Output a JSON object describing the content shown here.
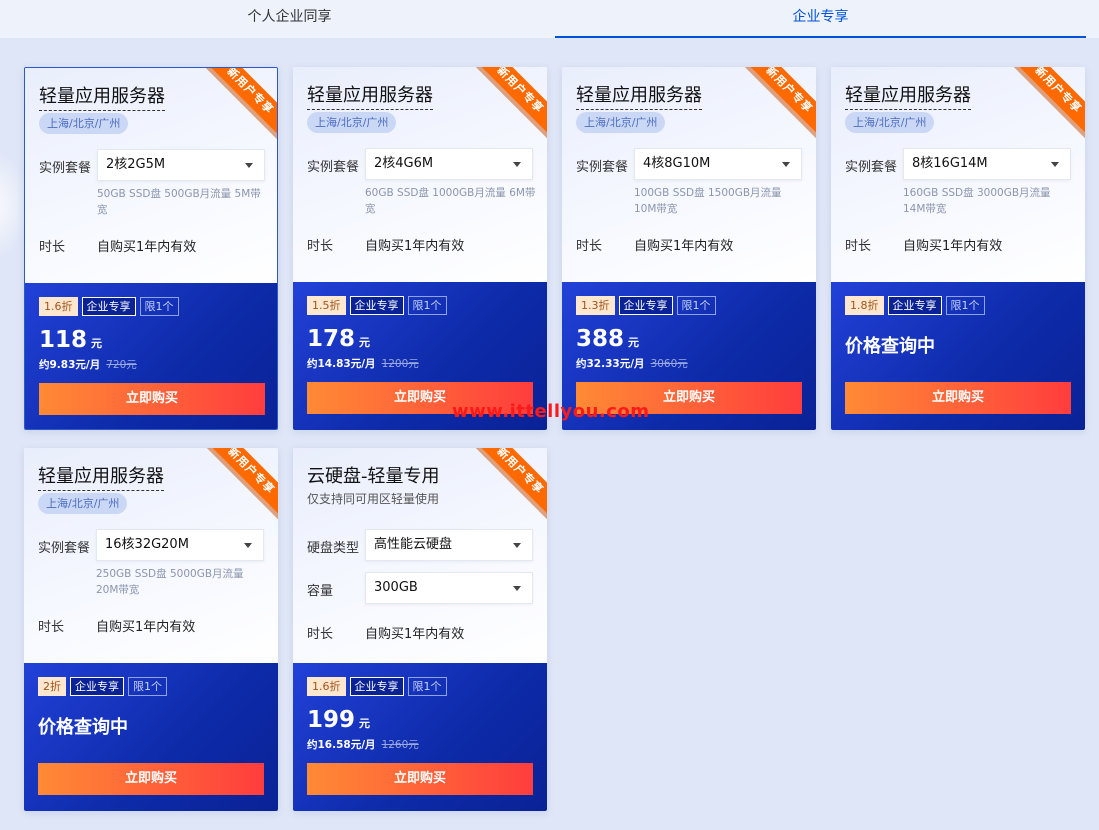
{
  "tabs": [
    {
      "label": "个人企业同享"
    },
    {
      "label": "企业专享"
    }
  ],
  "watermark": "www.ittellyou.com",
  "ribbon": "新用户专享",
  "labels": {
    "package": "实例套餐",
    "duration": "时长",
    "disk_type": "硬盘类型",
    "capacity": "容量",
    "buy": "立即购买",
    "querying": "价格查询中",
    "enterprise": "企业专享",
    "limit": "限1个",
    "price_unit": "元"
  },
  "cards": [
    {
      "title": "轻量应用服务器",
      "region": "上海/北京/广州",
      "package": "2核2G5M",
      "desc": "50GB SSD盘 500GB月流量 5M带宽",
      "duration": "自购买1年内有效",
      "discount": "1.6折",
      "price": "118",
      "monthly": "约9.83元/月",
      "original": "720元"
    },
    {
      "title": "轻量应用服务器",
      "region": "上海/北京/广州",
      "package": "2核4G6M",
      "desc": "60GB SSD盘 1000GB月流量 6M带宽",
      "duration": "自购买1年内有效",
      "discount": "1.5折",
      "price": "178",
      "monthly": "约14.83元/月",
      "original": "1200元"
    },
    {
      "title": "轻量应用服务器",
      "region": "上海/北京/广州",
      "package": "4核8G10M",
      "desc": "100GB SSD盘 1500GB月流量 10M带宽",
      "duration": "自购买1年内有效",
      "discount": "1.3折",
      "price": "388",
      "monthly": "约32.33元/月",
      "original": "3060元"
    },
    {
      "title": "轻量应用服务器",
      "region": "上海/北京/广州",
      "package": "8核16G14M",
      "desc": "160GB SSD盘 3000GB月流量 14M带宽",
      "duration": "自购买1年内有效",
      "discount": "1.8折"
    },
    {
      "title": "轻量应用服务器",
      "region": "上海/北京/广州",
      "package": "16核32G20M",
      "desc": "250GB SSD盘 5000GB月流量 20M带宽",
      "duration": "自购买1年内有效",
      "discount": "2折"
    },
    {
      "title": "云硬盘-轻量专用",
      "subtitle": "仅支持同可用区轻量使用",
      "disk_type": "高性能云硬盘",
      "capacity": "300GB",
      "duration": "自购买1年内有效",
      "discount": "1.6折",
      "price": "199",
      "monthly": "约16.58元/月",
      "original": "1260元"
    }
  ]
}
